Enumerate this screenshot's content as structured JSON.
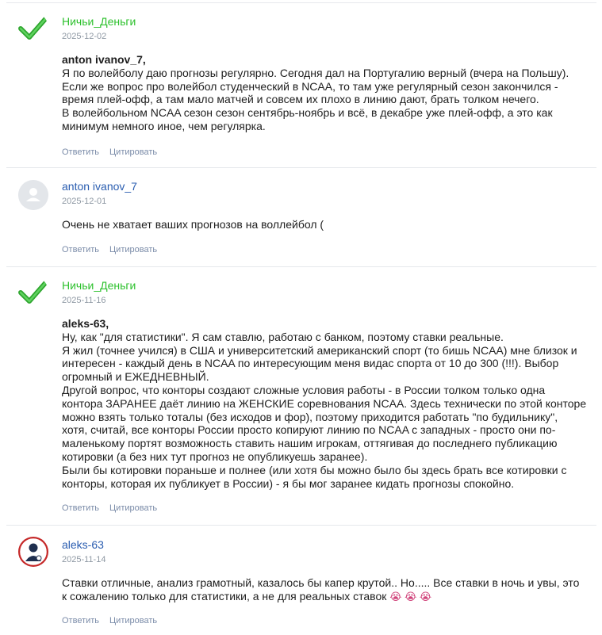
{
  "comments": [
    {
      "author": "Ничьи_Деньги",
      "date": "2025-12-02",
      "quote_author": "anton ivanov_7,",
      "lines": [
        "Я по волейболу даю прогнозы регулярно. Сегодня дал на Португалию верный (вчера на Польшу).",
        "Если же вопрос про волейбол студенческий в NCAA, то там уже регулярный сезон закончился -",
        "время плей-офф, а там мало матчей и совсем их плохо в линию дают, брать толком нечего.",
        "В волейбольном NCAA сезон сезон сентябрь-ноябрь и всё, в декабре уже плей-офф, а это как",
        "минимум немного иное, чем регулярка."
      ],
      "reply_label": "Ответить",
      "quote_label": "Цитировать"
    },
    {
      "author": "anton ivanov_7",
      "date": "2025-12-01",
      "lines": [
        "Очень не хватает ваших прогнозов на воллейбол ("
      ],
      "reply_label": "Ответить",
      "quote_label": "Цитировать"
    },
    {
      "author": "Ничьи_Деньги",
      "date": "2025-11-16",
      "quote_author": "aleks-63,",
      "lines": [
        "Ну, как \"для статистики\". Я сам ставлю, работаю с банком, поэтому ставки реальные.",
        "Я жил (точнее учился) в США и университетский американский спорт (то бишь NCAA) мне близок и",
        "интересен - каждый день в NCAA по интересующим меня видас спорта от 10 до 300 (!!!). Выбор",
        "огромный и ЕЖЕДНЕВНЫЙ.",
        "Другой вопрос, что конторы создают сложные условия работы - в России толком только одна",
        "контора ЗАРАНЕЕ даёт линию на ЖЕНСКИЕ соревнования NCAA. Здесь технически по этой конторе",
        "можно взять только тоталы (без исходов и фор), поэтому приходится работать \"по будильнику\",",
        "хотя, считай, все конторы России просто копируют линию по NCAA с западных - просто они по-",
        "маленькому портят возможность ставить нашим игрокам, оттягивая до последнего публикацию",
        "котировки (а без них тут прогноз не опубликуешь заранее).",
        "Были бы котировки пораньше и полнее (или хотя бы можно было бы здесь брать все котировки с",
        "конторы, которая их публикует в России) - я бы мог заранее кидать прогнозы спокойно."
      ],
      "reply_label": "Ответить",
      "quote_label": "Цитировать"
    },
    {
      "author": "aleks-63",
      "date": "2025-11-14",
      "lines": [
        "Ставки отличные, анализ грамотный, казалось бы капер крутой.. Но..... Все ставки в ночь и увы, это",
        "к сожалению только для статистики, а не для реальных ставок"
      ],
      "emoji": "😭 😭 😭",
      "reply_label": "Ответить",
      "quote_label": "Цитировать"
    }
  ]
}
